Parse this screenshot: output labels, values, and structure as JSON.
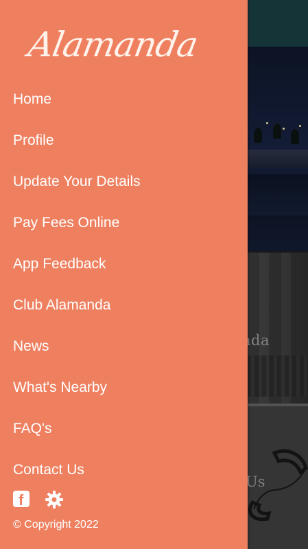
{
  "background": {
    "card2_label": "nda",
    "card3_label": "Us"
  },
  "drawer": {
    "logo_text": "Alamanda",
    "menu": [
      {
        "label": "Home"
      },
      {
        "label": "Profile"
      },
      {
        "label": "Update Your Details"
      },
      {
        "label": "Pay Fees Online"
      },
      {
        "label": "App Feedback"
      },
      {
        "label": "Club Alamanda"
      },
      {
        "label": "News"
      },
      {
        "label": "What's Nearby"
      },
      {
        "label": "FAQ's"
      },
      {
        "label": "Contact Us"
      }
    ],
    "social_icons": [
      "facebook-icon",
      "gear-icon"
    ],
    "copyright": "© Copyright 2022"
  },
  "colors": {
    "drawer_background": "#ee8060",
    "header_background": "#17393d",
    "text": "#ffffff"
  }
}
